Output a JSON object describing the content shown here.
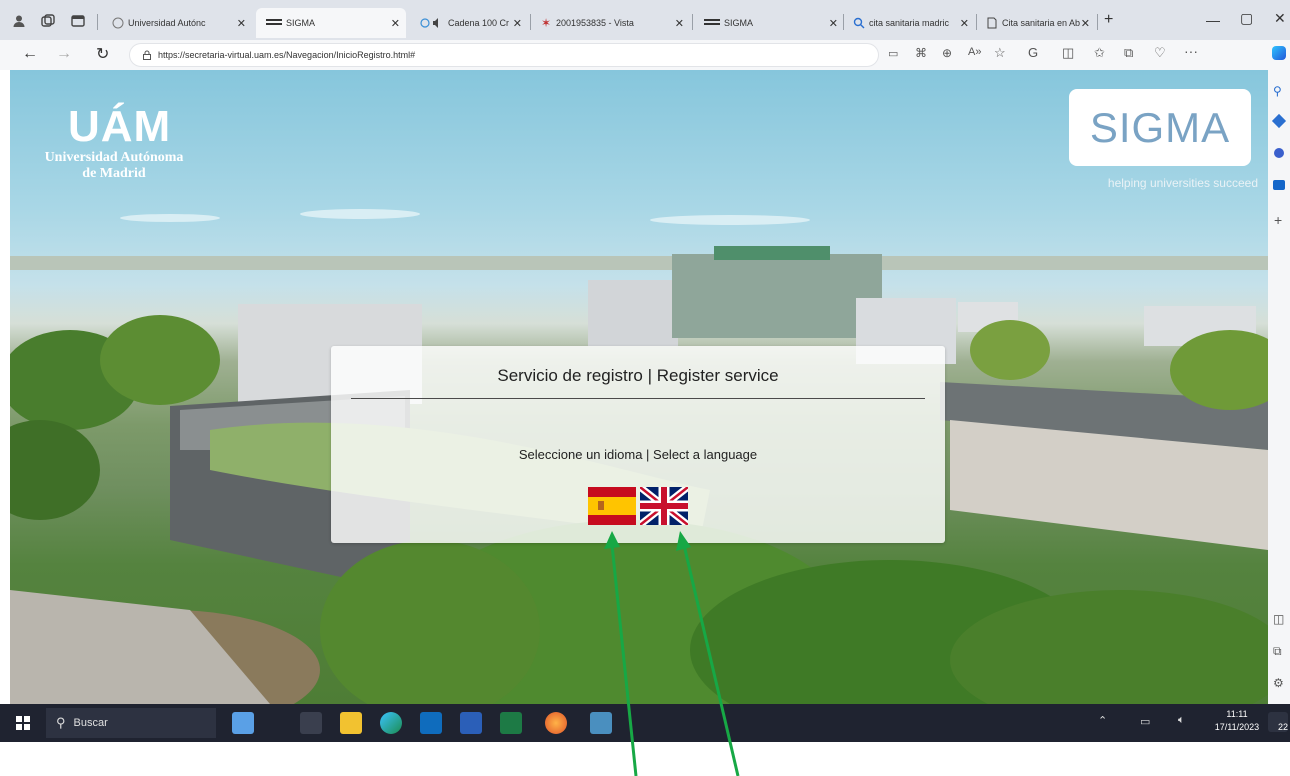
{
  "browser": {
    "tabs": [
      {
        "title": "Universidad Autónc",
        "active": false
      },
      {
        "title": "SIGMA",
        "active": true
      },
      {
        "title": "Cadena 100 Cr",
        "active": false
      },
      {
        "title": "2001953835 - Vista",
        "active": false
      },
      {
        "title": "SIGMA",
        "active": false
      },
      {
        "title": "cita sanitaria madric",
        "active": false
      },
      {
        "title": "Cita sanitaria en Ab",
        "active": false
      }
    ],
    "new_tab": "+",
    "url": "https://secretaria-virtual.uam.es/Navegacion/InicioRegistro.html#",
    "window_controls": [
      "minimize",
      "maximize",
      "close"
    ]
  },
  "page": {
    "uam_logo_text": "UÁM",
    "uam_name_line1": "Universidad Autónoma",
    "uam_name_line2": "de Madrid",
    "sigma_logo": "SIGMA",
    "sigma_tagline": "helping universities succeed",
    "panel_title": "Servicio de registro | Register service",
    "panel_subtitle": "Seleccione un idioma | Select a language",
    "languages": [
      {
        "code": "es",
        "flag": "spain-flag"
      },
      {
        "code": "en",
        "flag": "uk-flag"
      }
    ]
  },
  "taskbar": {
    "search_placeholder": "Buscar",
    "time": "11:11",
    "date": "17/11/2023",
    "notification_count": "22"
  },
  "colors": {
    "annotation_arrow": "#17a845",
    "taskbar": "#1f2330",
    "sigma_blue": "#7aa3c4"
  }
}
